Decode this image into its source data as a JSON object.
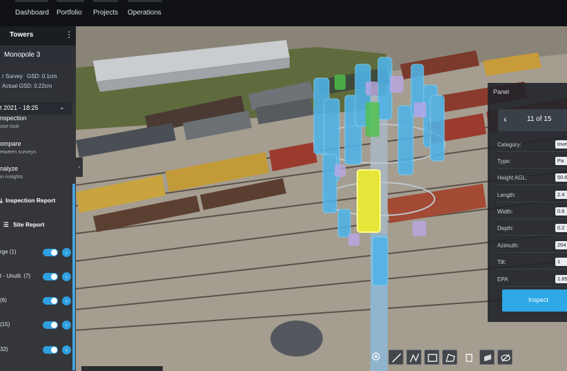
{
  "nav": {
    "tabs": [
      "Dashboard",
      "Portfolio",
      "Projects",
      "Operations"
    ]
  },
  "sidebar": {
    "title": "Towers",
    "tower_name": "Monopole 3",
    "survey_label": "r Survey",
    "gsd_label": "GSD: 0.1cm",
    "actual_gsd_label": "Actual GSD: 0.22cm",
    "date_label": "t 2021 - 18:25",
    "items": [
      {
        "title": "nspection",
        "subtitle": "ose look"
      },
      {
        "title": "ompare",
        "subtitle": "etween surveys"
      },
      {
        "title": "nalyze",
        "subtitle": "in insights"
      }
    ],
    "inspection_report": "Inspection Report",
    "site_report": "Site Report",
    "layers": [
      {
        "label": "rge",
        "count": "(1)"
      },
      {
        "label": "t - Unutil.",
        "count": "(7)"
      },
      {
        "label": "",
        "count": "(6)"
      },
      {
        "label": "",
        "count": "(15)"
      },
      {
        "label": "",
        "count": "32)"
      }
    ]
  },
  "panel": {
    "title": "Panel",
    "pager": "11 of 15",
    "properties": [
      {
        "key": "Category:",
        "value": "Inven"
      },
      {
        "key": "Type:",
        "value": "Pa"
      },
      {
        "key": "Height AGL:",
        "value": "50.6"
      },
      {
        "key": "Length:",
        "value": "2.4"
      },
      {
        "key": "Width:",
        "value": "0.6"
      },
      {
        "key": "Depth:",
        "value": "0.2"
      },
      {
        "key": "Azimuth:",
        "value": "264"
      },
      {
        "key": "Tilt:",
        "value": "1"
      },
      {
        "key": "EPA",
        "value": "1.85"
      }
    ],
    "inspect_label": "Inspect"
  },
  "toolbar": {
    "tools": [
      "point-icon",
      "line-icon",
      "polyline-icon",
      "box-icon",
      "area-icon",
      "delete-icon",
      "layers-icon",
      "hide-icon"
    ]
  },
  "colors": {
    "accent": "#2ea8e6",
    "antenna": "#4fb3e8",
    "selected_antenna": "#e6e63a"
  }
}
